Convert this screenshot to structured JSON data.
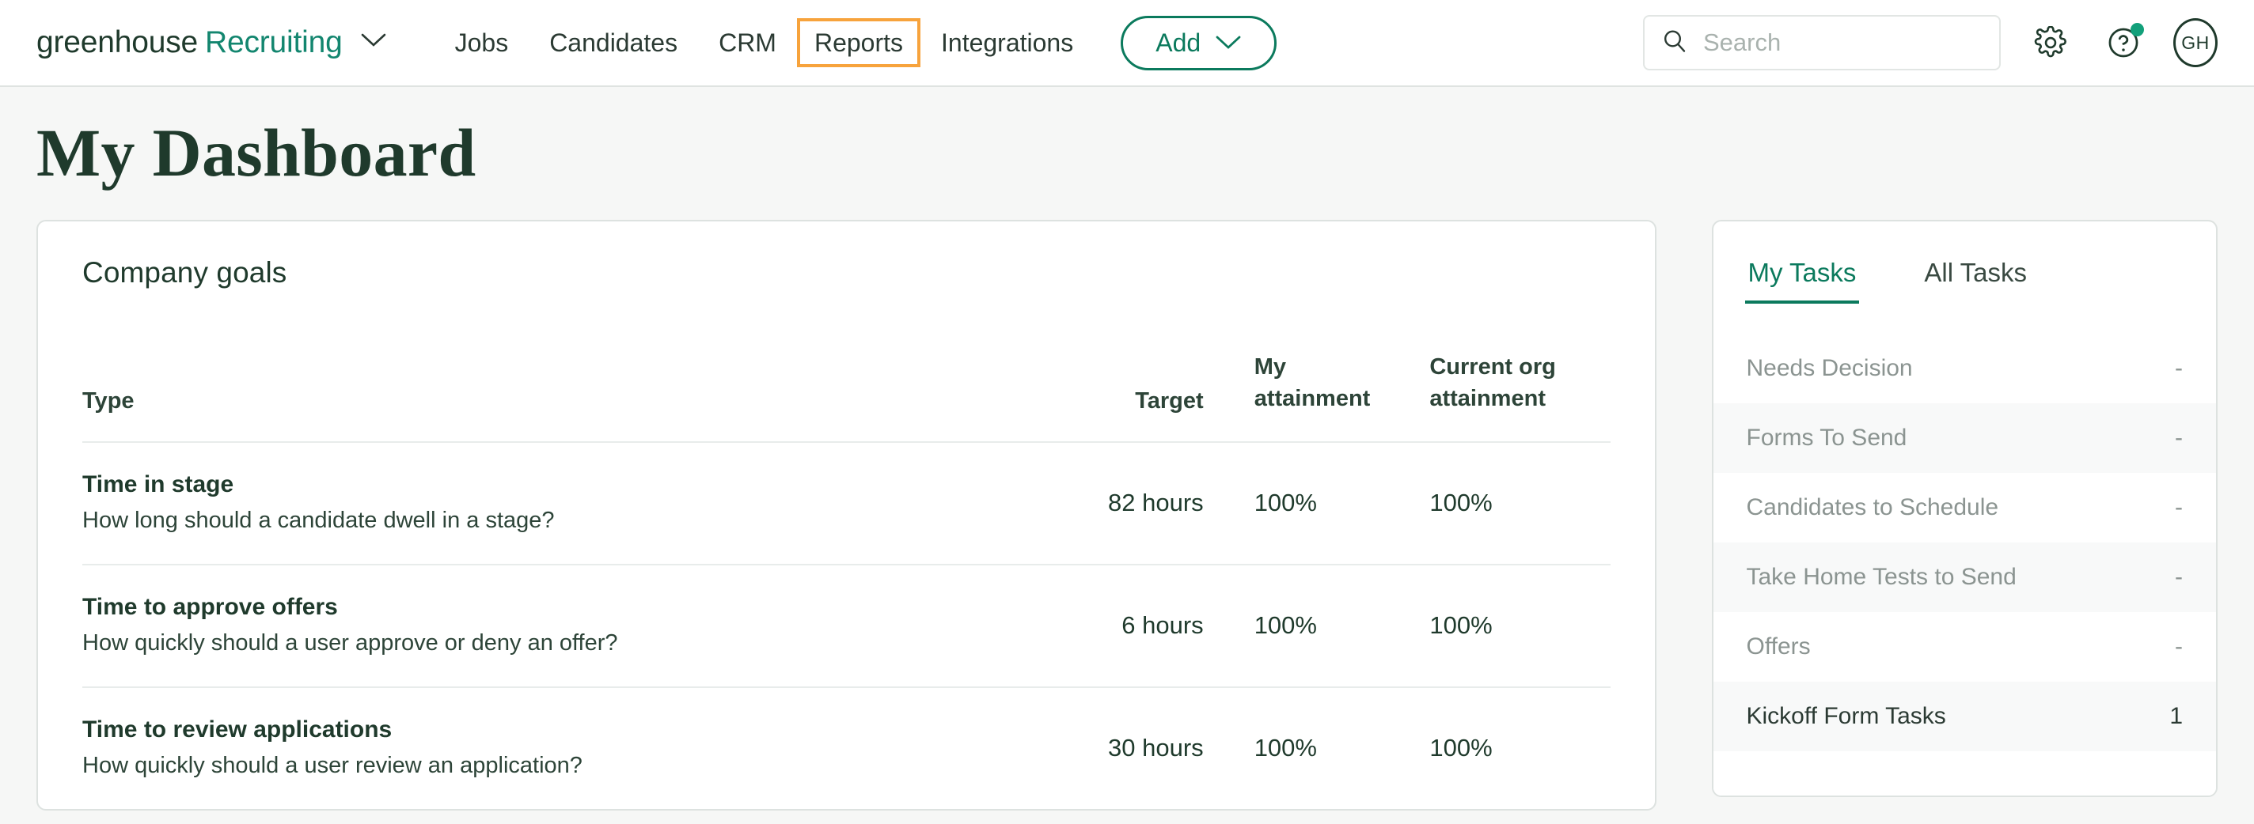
{
  "header": {
    "brand": {
      "name": "greenhouse",
      "product": "Recruiting",
      "caret_icon": "chevron-down-icon"
    },
    "nav": [
      {
        "label": "Jobs",
        "highlighted": false
      },
      {
        "label": "Candidates",
        "highlighted": false
      },
      {
        "label": "CRM",
        "highlighted": false
      },
      {
        "label": "Reports",
        "highlighted": true
      },
      {
        "label": "Integrations",
        "highlighted": false
      }
    ],
    "add_button": {
      "label": "Add",
      "caret_icon": "chevron-down-icon"
    },
    "search": {
      "placeholder": "Search",
      "value": "",
      "icon": "search-icon"
    },
    "settings_icon": "gear-icon",
    "help_icon": "question-mark-icon",
    "avatar": {
      "initials": "GH"
    },
    "highlight_color": "#f7a33c",
    "accent_color": "#0b7a5d"
  },
  "page": {
    "title": "My Dashboard"
  },
  "goals": {
    "card_title": "Company goals",
    "columns": {
      "type": "Type",
      "target": "Target",
      "my_attainment": "My attainment",
      "org_attainment": "Current org attainment"
    },
    "rows": [
      {
        "name": "Time in stage",
        "description": "How long should a candidate dwell in a stage?",
        "target": "82 hours",
        "my_attainment": "100%",
        "org_attainment": "100%"
      },
      {
        "name": "Time to approve offers",
        "description": "How quickly should a user approve or deny an offer?",
        "target": "6 hours",
        "my_attainment": "100%",
        "org_attainment": "100%"
      },
      {
        "name": "Time to review applications",
        "description": "How quickly should a user review an application?",
        "target": "30 hours",
        "my_attainment": "100%",
        "org_attainment": "100%"
      }
    ]
  },
  "tasks": {
    "tabs": [
      {
        "label": "My Tasks",
        "active": true
      },
      {
        "label": "All Tasks",
        "active": false
      }
    ],
    "items": [
      {
        "label": "Needs Decision",
        "count": "-"
      },
      {
        "label": "Forms To Send",
        "count": "-"
      },
      {
        "label": "Candidates to Schedule",
        "count": "-"
      },
      {
        "label": "Take Home Tests to Send",
        "count": "-"
      },
      {
        "label": "Offers",
        "count": "-"
      },
      {
        "label": "Kickoff Form Tasks",
        "count": "1"
      }
    ]
  }
}
